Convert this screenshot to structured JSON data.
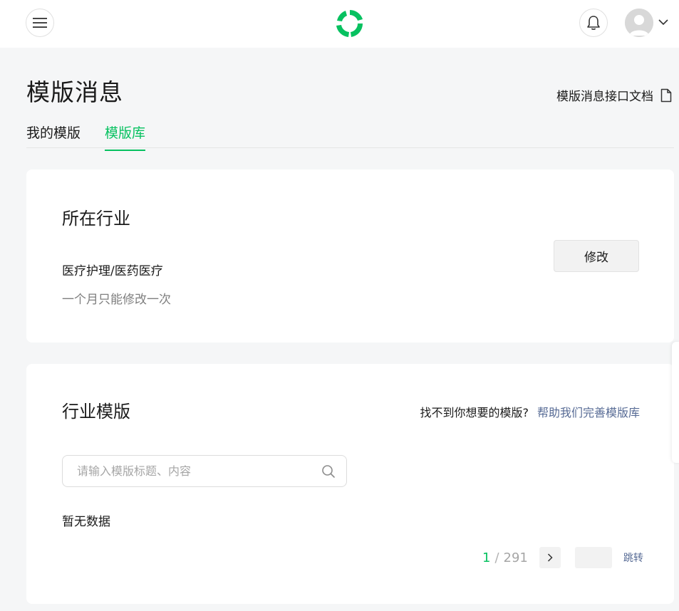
{
  "header": {
    "menu_icon": "hamburger-menu-icon",
    "logo_icon": "wechat-green-logo",
    "bell_icon": "bell-icon",
    "avatar_icon": "default-user-avatar",
    "caret_icon": "chevron-down-icon"
  },
  "page": {
    "title": "模版消息",
    "doc_link": "模版消息接口文档",
    "doc_icon": "document-icon"
  },
  "tabs": [
    {
      "label": "我的模版",
      "active": false
    },
    {
      "label": "模版库",
      "active": true
    }
  ],
  "industry": {
    "title": "所在行业",
    "value": "医疗护理/医药医疗",
    "tip": "一个月只能修改一次",
    "edit_label": "修改"
  },
  "templates": {
    "title": "行业模版",
    "help_text": "找不到你想要的模版?",
    "help_link": "帮助我们完善模版库",
    "search_placeholder": "请输入模版标题、内容",
    "search_value": "",
    "empty_text": "暂无数据"
  },
  "pagination": {
    "current": "1",
    "separator": "/",
    "total": "291",
    "jump_label": "跳转",
    "jump_value": ""
  },
  "colors": {
    "accent": "#07c160",
    "link": "#576b95",
    "background": "#f5f6f7"
  }
}
